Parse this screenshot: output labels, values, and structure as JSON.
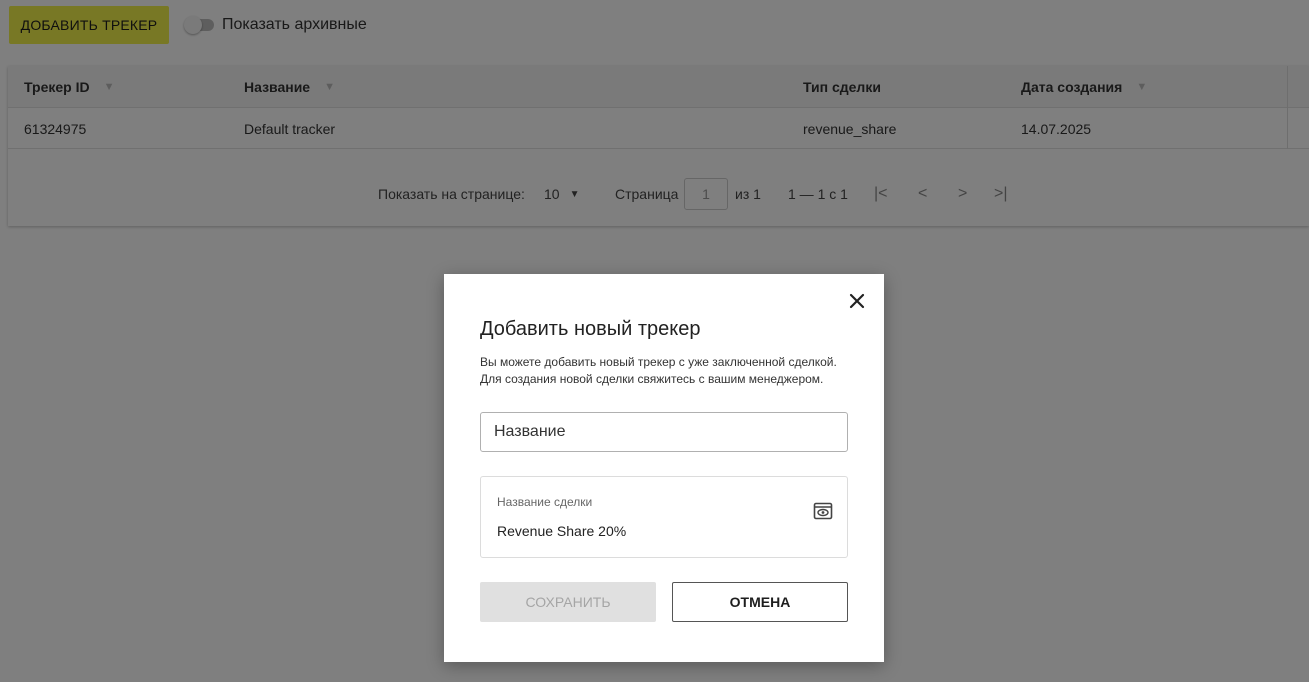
{
  "toolbar": {
    "add_tracker_label": "ДОБАВИТЬ ТРЕКЕР",
    "show_archived_label": "Показать архивные",
    "show_archived_checked": false
  },
  "table": {
    "columns": [
      {
        "label": "Трекер ID",
        "sortable": true
      },
      {
        "label": "Название",
        "sortable": true
      },
      {
        "label": "Тип сделки",
        "sortable": false
      },
      {
        "label": "Дата создания",
        "sortable": true
      }
    ],
    "rows": [
      {
        "id": "61324975",
        "name": "Default tracker",
        "deal_type": "revenue_share",
        "created": "14.07.2025"
      }
    ]
  },
  "pagination": {
    "per_page_label": "Показать на странице:",
    "per_page_value": "10",
    "page_label": "Страница",
    "page_value": "1",
    "of_label": "из 1",
    "range_label": "1 — 1 с 1"
  },
  "modal": {
    "title": "Добавить новый трекер",
    "description_line1": "Вы можете добавить новый трекер с уже заключенной сделкой.",
    "description_line2": "Для создания новой сделки свяжитесь с вашим менеджером.",
    "name_placeholder": "Название",
    "deal_label": "Название сделки",
    "deal_value": "Revenue Share 20%",
    "save_label": "СОХРАНИТЬ",
    "cancel_label": "ОТМЕНА"
  },
  "colors": {
    "accent": "#f1f14a",
    "overlay": "rgba(0,0,0,0.5)",
    "disabled_button": "#e0e0e0"
  }
}
